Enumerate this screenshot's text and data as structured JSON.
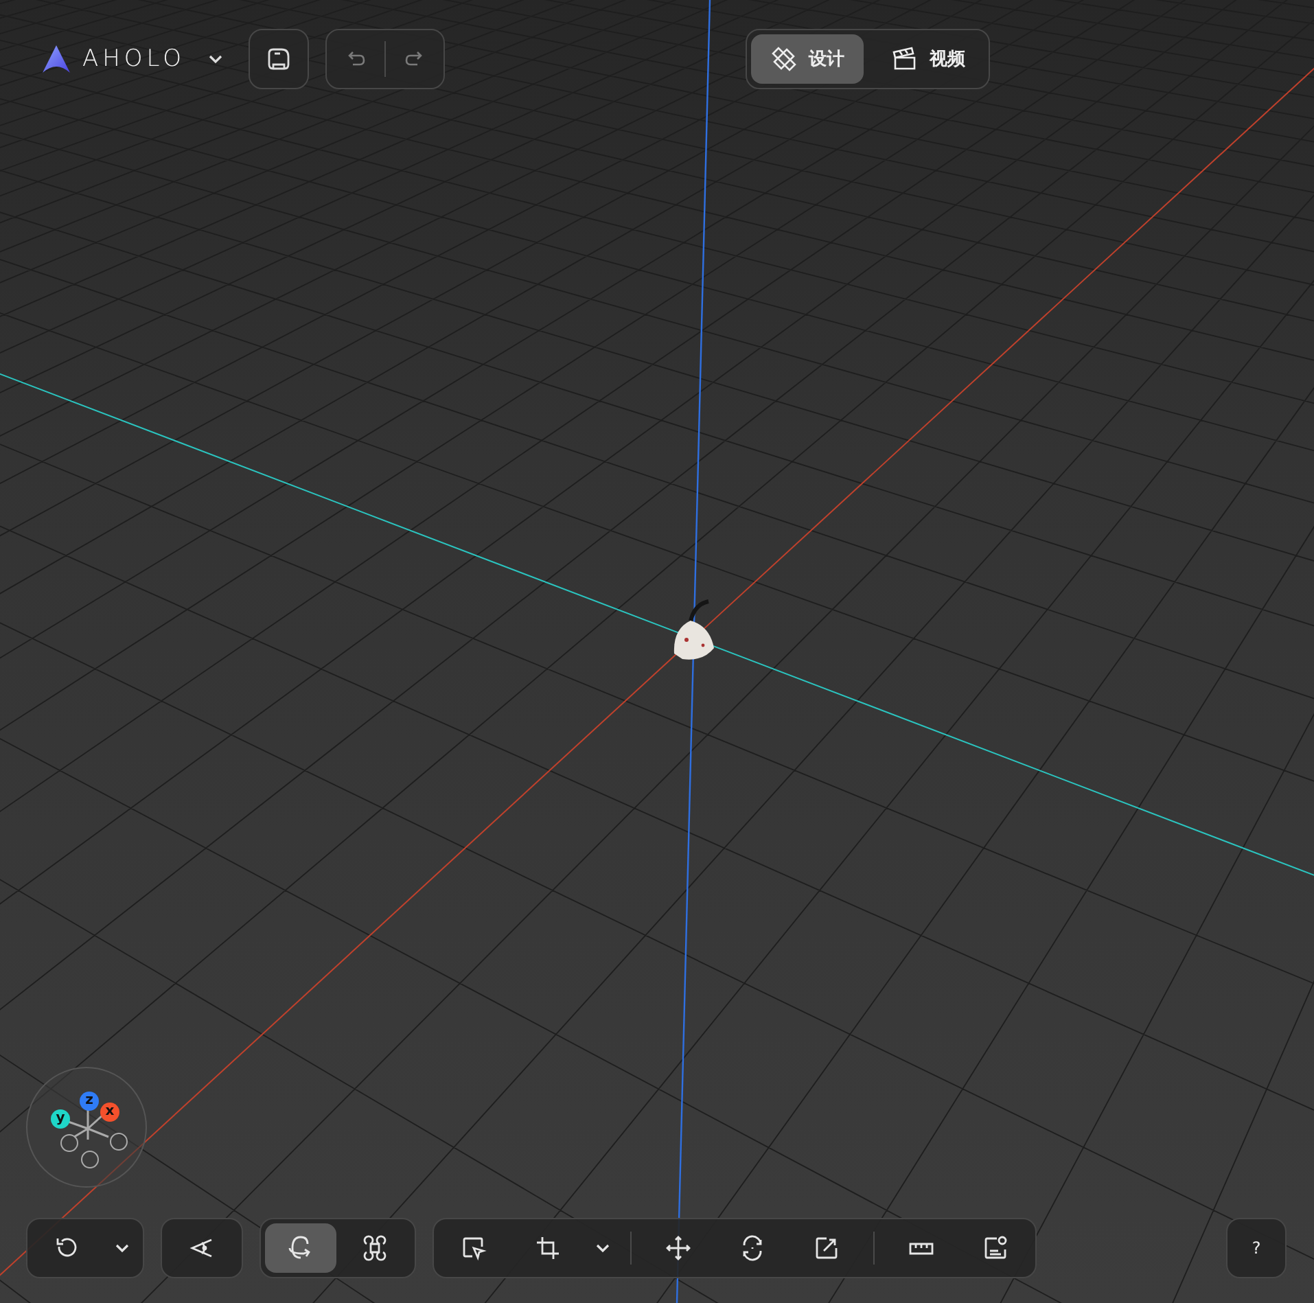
{
  "header": {
    "brand": "AHOLO",
    "history": [
      {
        "kind": "undo",
        "disabled": true
      },
      {
        "kind": "redo",
        "disabled": true
      }
    ]
  },
  "mode_tabs": [
    {
      "label": "设计",
      "kind": "design",
      "selected": true
    },
    {
      "label": "视频",
      "kind": "video",
      "selected": false
    }
  ],
  "axis_gizmo": {
    "axes": [
      {
        "label": "y",
        "color": "#1fd6c8"
      },
      {
        "label": "z",
        "color": "#2f7cf6"
      },
      {
        "label": "x",
        "color": "#f4512c"
      }
    ]
  },
  "bottom_toolbar": {
    "camera_tools": [
      {
        "kind": "reset-view"
      },
      {
        "kind": "dropdown"
      },
      {
        "kind": "view"
      }
    ],
    "navigation_modes": [
      {
        "kind": "orbit",
        "selected": true
      },
      {
        "kind": "pan",
        "selected": false
      }
    ],
    "edit_sections": [
      [
        {
          "kind": "select"
        },
        {
          "kind": "crop"
        },
        {
          "kind": "dropdown"
        }
      ],
      [
        {
          "kind": "move"
        },
        {
          "kind": "rotate"
        },
        {
          "kind": "scale"
        }
      ],
      [
        {
          "kind": "measure"
        },
        {
          "kind": "annotate"
        }
      ]
    ]
  },
  "help": {
    "label": "?"
  }
}
